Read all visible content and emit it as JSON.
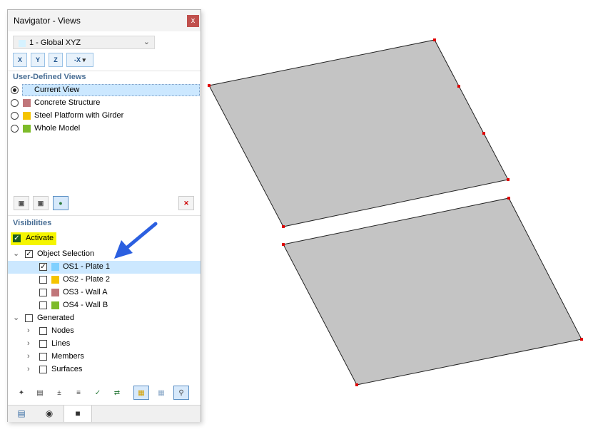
{
  "navigator": {
    "title": "Navigator - Views",
    "close_label": "x",
    "view_select": {
      "value": "1 - Global XYZ",
      "swatch_color": "#d6f2ff"
    },
    "axis_buttons": [
      {
        "label": "X",
        "icon": "view-x-icon"
      },
      {
        "label": "Y",
        "icon": "view-y-icon"
      },
      {
        "label": "Z",
        "icon": "view-z-icon"
      },
      {
        "label": "-X",
        "icon": "view-minus-x-icon"
      }
    ],
    "user_views": {
      "header": "User-Defined Views",
      "items": [
        {
          "label": "Current View",
          "selected": true,
          "color": ""
        },
        {
          "label": "Concrete Structure",
          "selected": false,
          "color": "#c0767a"
        },
        {
          "label": "Steel Platform with Girder",
          "selected": false,
          "color": "#f5c400"
        },
        {
          "label": "Whole Model",
          "selected": false,
          "color": "#7dbb2a"
        }
      ]
    },
    "visibilities": {
      "header": "Visibilities",
      "activate_label": "Activate",
      "object_selection": {
        "label": "Object Selection",
        "items": [
          {
            "label": "OS1 - Plate 1",
            "checked": true,
            "color": "#7fd0ff"
          },
          {
            "label": "OS2 - Plate 2",
            "checked": false,
            "color": "#f5c400"
          },
          {
            "label": "OS3 - Wall A",
            "checked": false,
            "color": "#c0767a"
          },
          {
            "label": "OS4 - Wall B",
            "checked": false,
            "color": "#7dbb2a"
          }
        ]
      },
      "generated": {
        "label": "Generated",
        "items": [
          "Nodes",
          "Lines",
          "Members",
          "Surfaces"
        ]
      }
    },
    "tabs": [
      {
        "icon": "data-tab-icon",
        "glyph": "▤"
      },
      {
        "icon": "display-eye-icon",
        "glyph": "◉"
      },
      {
        "icon": "views-camera-icon",
        "glyph": "■"
      }
    ]
  },
  "colors": {
    "accent": "#4a6f95",
    "selection": "#cce8ff",
    "activate_highlight": "#f5f500",
    "plate_fill": "#c4c4c4",
    "node_marker": "#e00000",
    "arrow": "#2b5fe0"
  }
}
